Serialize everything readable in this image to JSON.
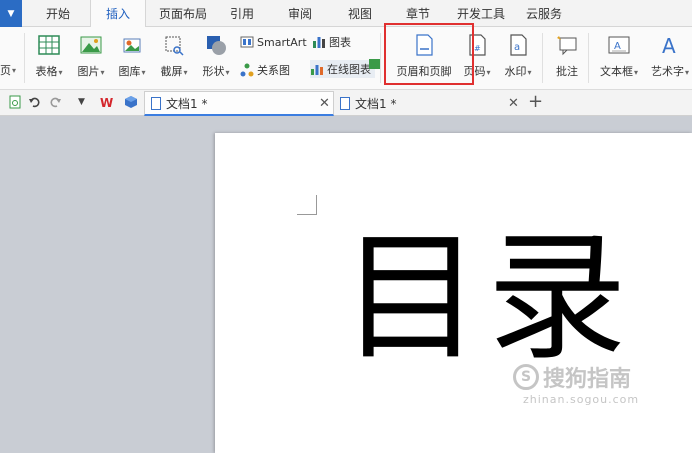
{
  "tabs": {
    "items": [
      {
        "label": "开始"
      },
      {
        "label": "插入"
      },
      {
        "label": "页面布局"
      },
      {
        "label": "引用"
      },
      {
        "label": "审阅"
      },
      {
        "label": "视图"
      },
      {
        "label": "章节"
      },
      {
        "label": "开发工具"
      },
      {
        "label": "云服务"
      }
    ],
    "active": "插入"
  },
  "ribbon": {
    "left_cut_label": "页",
    "table_label": "表格",
    "picture_label": "图片",
    "gallery_label": "图库",
    "screenshot_label": "截屏",
    "shape_label": "形状",
    "smartart_label": "SmartArt",
    "chart_label": "图表",
    "relation_label": "关系图",
    "online_chart_label": "在线图表",
    "header_footer_label": "页眉和页脚",
    "page_number_label": "页码",
    "watermark_label": "水印",
    "comment_label": "批注",
    "textbox_label": "文本框",
    "wordart_label": "艺术字"
  },
  "doc_tabs": [
    {
      "label": "文档1 *"
    },
    {
      "label": "文档1 *"
    }
  ],
  "document": {
    "big_text": "目录"
  },
  "watermark": {
    "brand": "搜狗指南",
    "url": "zhinan.sogou.com"
  },
  "colors": {
    "accent": "#1f5fbf",
    "highlight_box": "#e03030"
  }
}
